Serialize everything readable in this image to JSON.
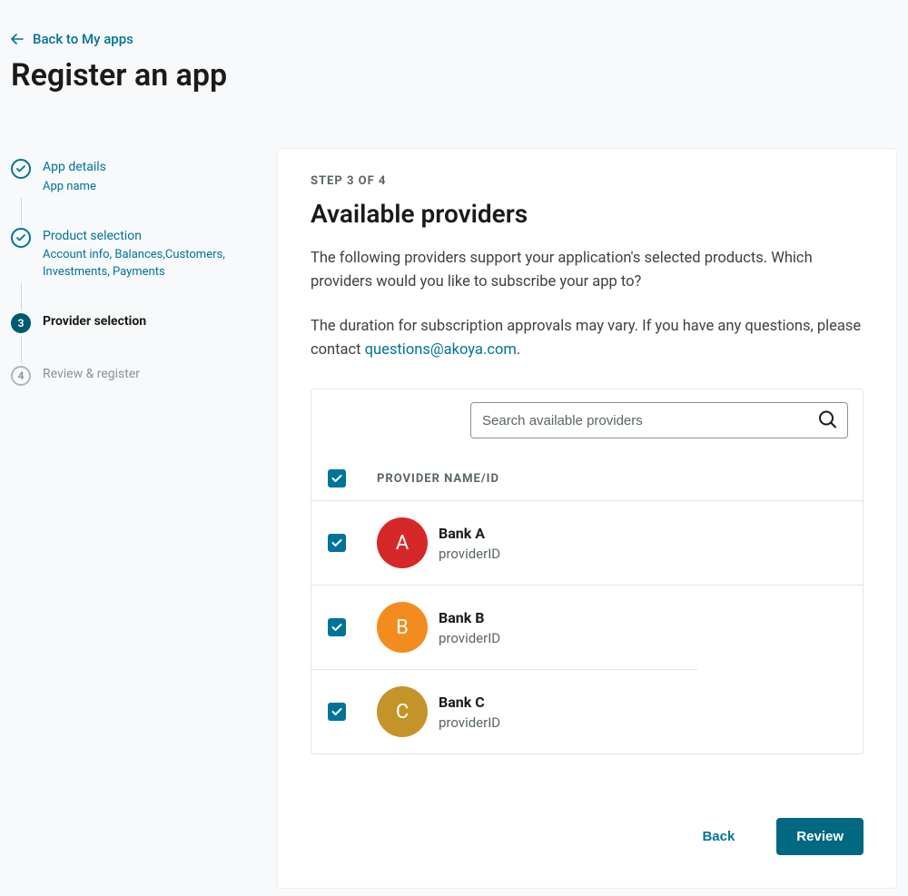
{
  "header": {
    "back_link": "Back to My apps",
    "title": "Register an app"
  },
  "stepper": {
    "steps": [
      {
        "label": "App details",
        "sub": "App name",
        "state": "completed"
      },
      {
        "label": "Product selection",
        "sub": "Account info, Balances,Customers, Investments, Payments",
        "state": "completed"
      },
      {
        "label": "Provider selection",
        "state": "current",
        "number": "3"
      },
      {
        "label": "Review & register",
        "state": "pending",
        "number": "4"
      }
    ]
  },
  "main": {
    "eyebrow": "STEP 3 OF 4",
    "title": "Available providers",
    "desc1": "The following providers support your application's selected products. Which providers would you like to subscribe your app to?",
    "desc2_prefix": "The duration for subscription approvals may vary. If you have any questions, please contact ",
    "desc2_link": "questions@akoya.com",
    "desc2_suffix": ".",
    "search_placeholder": "Search available providers",
    "column_header": "PROVIDER NAME/ID",
    "providers": [
      {
        "initial": "A",
        "name": "Bank A",
        "id": "providerID",
        "color": "#d62828"
      },
      {
        "initial": "B",
        "name": "Bank B",
        "id": "providerID",
        "color": "#f28c1e"
      },
      {
        "initial": "C",
        "name": "Bank C",
        "id": "providerID",
        "color": "#c4942b"
      }
    ],
    "back_label": "Back",
    "review_label": "Review"
  }
}
